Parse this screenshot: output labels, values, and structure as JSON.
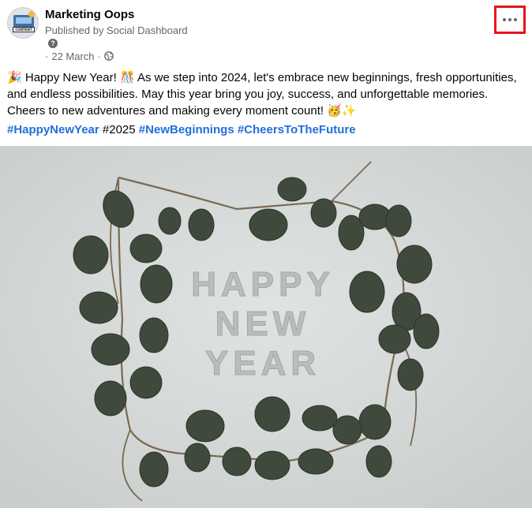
{
  "page": {
    "name": "Marketing Oops",
    "published_by": "Published by Social Dashboard",
    "date": "22 March",
    "separator_before": "·",
    "separator_after": "·",
    "avatar_label": "CONTENT"
  },
  "post": {
    "emoji_party": "🎉",
    "text_1": " Happy New Year! ",
    "emoji_confetti": "🎊",
    "text_2": " As we step into 2024, let's embrace new beginnings, fresh opportunities, and endless possibilities. May this year bring you joy, success, and unforgettable memories. Cheers to new adventures and making every moment count! ",
    "emoji_end": "🥳✨",
    "hashtags": [
      "#HappyNewYear",
      "#2025",
      "#NewBeginnings",
      "#CheersToTheFuture"
    ]
  },
  "photo": {
    "line_1": "HAPPY",
    "line_2": "NEW",
    "line_3": "YEAR"
  },
  "icons": {
    "more": "more-horizontal-icon",
    "globe": "globe-icon",
    "help": "question-icon"
  },
  "colors": {
    "highlight_border": "#e8141c",
    "hashtag": "#216fdb",
    "muted_text": "#65676b",
    "photo_background": "#d5d9d8",
    "leaf": "#3f4a3d"
  }
}
